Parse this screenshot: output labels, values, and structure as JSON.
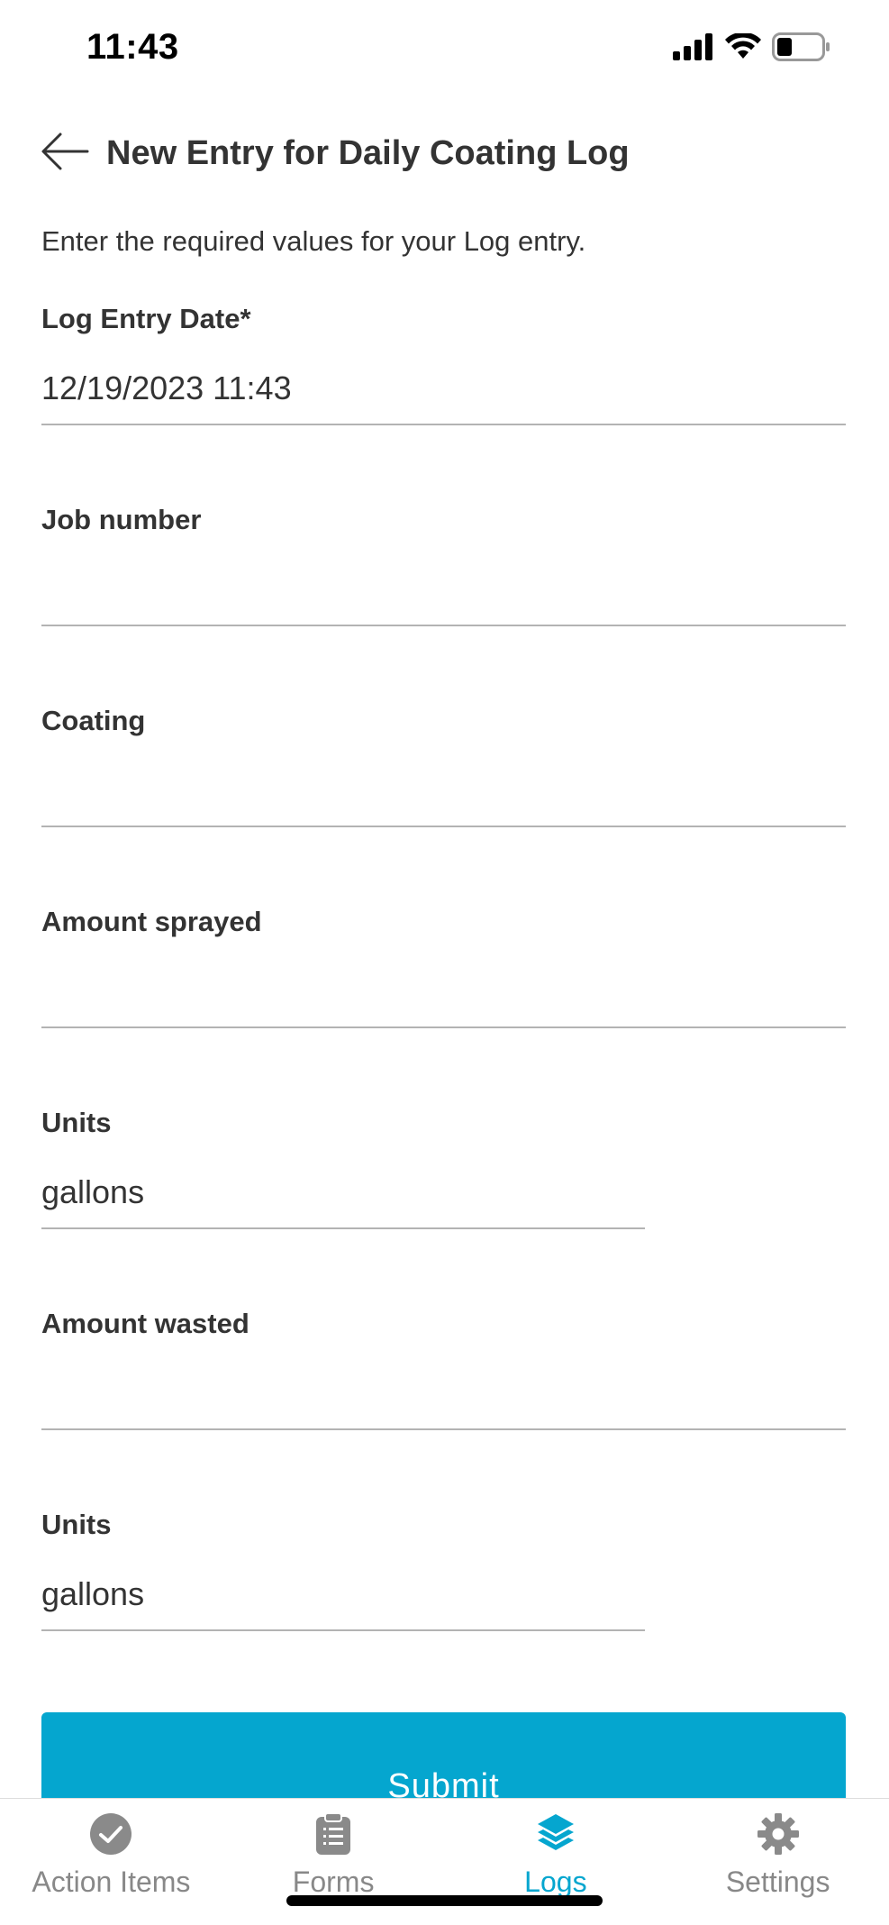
{
  "status_bar": {
    "time": "11:43"
  },
  "header": {
    "title": "New Entry for Daily Coating Log"
  },
  "intro_text": "Enter the required values for your Log entry.",
  "form": {
    "fields": [
      {
        "label": "Log Entry Date*",
        "value": "12/19/2023 11:43"
      },
      {
        "label": "Job number",
        "value": ""
      },
      {
        "label": "Coating",
        "value": ""
      },
      {
        "label": "Amount sprayed",
        "value": ""
      },
      {
        "label": "Units",
        "value": "gallons"
      },
      {
        "label": "Amount wasted",
        "value": ""
      },
      {
        "label": "Units",
        "value": "gallons"
      }
    ],
    "submit_label": "Submit"
  },
  "tab_bar": {
    "tabs": [
      {
        "label": "Action Items",
        "icon": "check-circle-icon"
      },
      {
        "label": "Forms",
        "icon": "clipboard-icon"
      },
      {
        "label": "Logs",
        "icon": "layers-icon"
      },
      {
        "label": "Settings",
        "icon": "gear-icon"
      }
    ],
    "active": "Logs"
  },
  "colors": {
    "accent": "#05a6cf",
    "inactive": "#888888",
    "text": "#333333",
    "divider": "#b3b3b3"
  }
}
